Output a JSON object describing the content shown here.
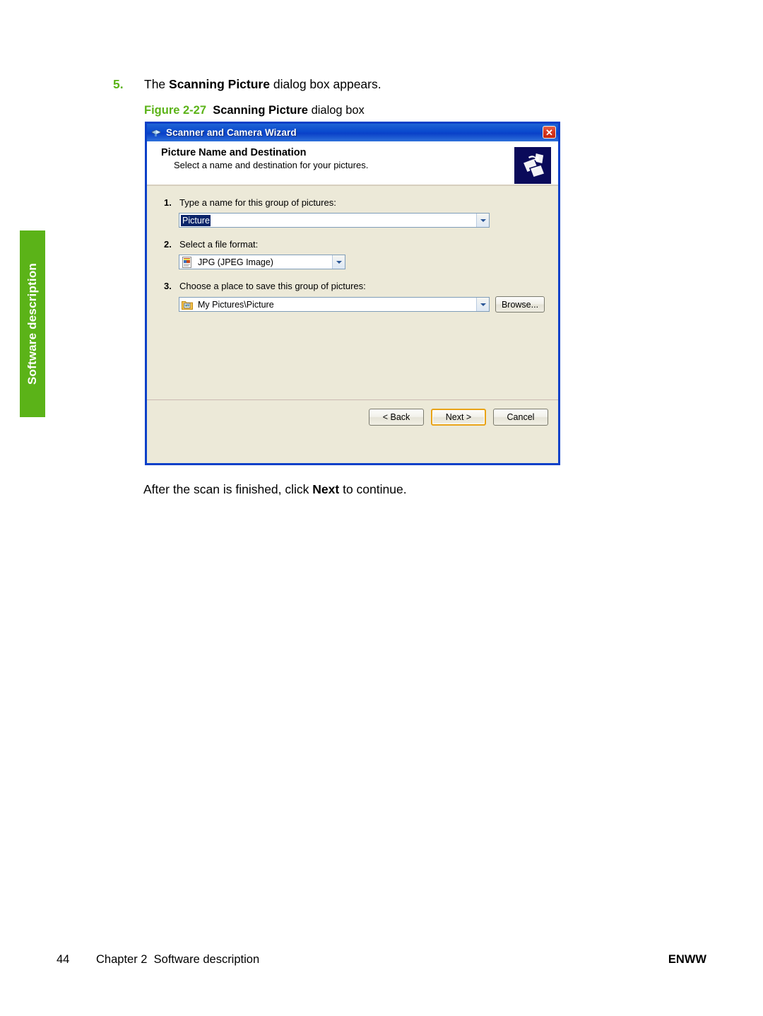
{
  "page": {
    "side_tab_label": "Software description",
    "accent_green": "#5BB318"
  },
  "step": {
    "number": "5.",
    "text_before": "The ",
    "bold_term": "Scanning Picture",
    "text_after": " dialog box appears."
  },
  "figure": {
    "label": "Figure 2-27",
    "bold_term": "Scanning Picture",
    "text_after": " dialog box"
  },
  "dialog": {
    "titlebar": {
      "title": "Scanner and Camera Wizard",
      "icon": "scanner-camera-icon",
      "close_label": "✕"
    },
    "header": {
      "title": "Picture Name and Destination",
      "subtitle": "Select a name and destination for your pictures.",
      "image": "scanner-wizard-banner-icon"
    },
    "fields": [
      {
        "number": "1.",
        "label": "Type a name for this group of pictures:",
        "control": "combobox-editable",
        "value": "Picture",
        "value_selected": true,
        "icon": null
      },
      {
        "number": "2.",
        "label": "Select a file format:",
        "control": "combobox",
        "value": "JPG (JPEG Image)",
        "value_selected": false,
        "icon": "jpg-file-icon"
      },
      {
        "number": "3.",
        "label": "Choose a place to save this group of pictures:",
        "control": "combobox",
        "value": "My Pictures\\Picture",
        "value_selected": false,
        "icon": "pictures-folder-icon",
        "browse_label": "Browse..."
      }
    ],
    "buttons": [
      {
        "label": "< Back",
        "default": false
      },
      {
        "label": "Next >",
        "default": true
      },
      {
        "label": "Cancel",
        "default": false
      }
    ]
  },
  "after_text": {
    "text_before": "After the scan is finished, click ",
    "bold_term": "Next",
    "text_after": " to continue."
  },
  "footer": {
    "page_number": "44",
    "chapter": "Chapter 2",
    "section": "Software description",
    "right": "ENWW"
  }
}
